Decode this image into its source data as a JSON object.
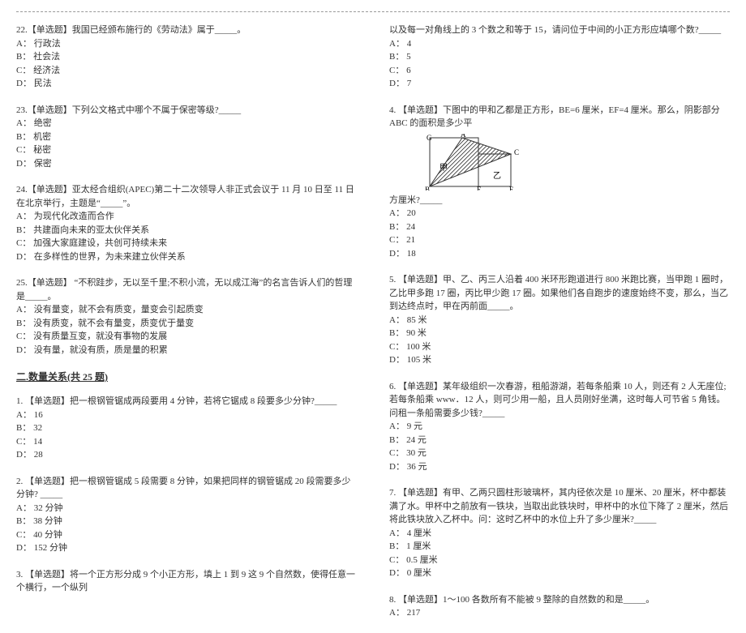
{
  "left": {
    "q22": {
      "stem": "22.【单选题】我国已经颁布施行的《劳动法》属于_____。",
      "a": "A： 行政法",
      "b": "B： 社会法",
      "c": "C： 经济法",
      "d": "D： 民法"
    },
    "q23": {
      "stem": "23.【单选题】下列公文格式中哪个不属于保密等级?_____",
      "a": "A： 绝密",
      "b": "B： 机密",
      "c": "C： 秘密",
      "d": "D： 保密"
    },
    "q24": {
      "stem": "24.【单选题】亚太经合组织(APEC)第二十二次领导人非正式会议于 11 月 10 日至 11 日在北京举行，主题是“_____”。",
      "a": "A： 为现代化改造而合作",
      "b": "B： 共建面向未来的亚太伙伴关系",
      "c": "C： 加强大家庭建设，共创可持续未来",
      "d": "D： 在多样性的世界，为未来建立伙伴关系"
    },
    "q25": {
      "stem": "25.【单选题】 “不积跬步，无以至千里;不积小流，无以成江海”的名言告诉人们的哲理是_____。",
      "a": "A： 没有量变，就不会有质变，量变会引起质变",
      "b": "B： 没有质变，就不会有量变，质变优于量变",
      "c": "C： 没有质量互变，就没有事物的发展",
      "d": "D： 没有量，就没有质，质是量的积累"
    },
    "section": "二.数量关系(共 25 题)",
    "q1b": {
      "stem": "1. 【单选题】把一根钢管锯成两段要用 4 分钟，若将它锯成 8 段要多少分钟?_____",
      "a": "A： 16",
      "b": "B： 32",
      "c": "C： 14",
      "d": "D： 28"
    },
    "q2b": {
      "stem": "2. 【单选题】把一根钢管锯成 5 段需要 8 分钟，如果把同样的钢管锯成 20 段需要多少分钟? _____",
      "a": "A： 32 分钟",
      "b": "B： 38 分钟",
      "c": "C： 40 分钟",
      "d": "D： 152 分钟"
    },
    "q3b": {
      "stem": "3. 【单选题】将一个正方形分成 9 个小正方形，填上 1 到 9 这 9 个自然数，使得任意一个横行，一个纵列"
    }
  },
  "right": {
    "q3cont": {
      "stem": "以及每一对角线上的 3 个数之和等于 15，请问位于中间的小正方形应填哪个数?_____",
      "a": "A： 4",
      "b": "B： 5",
      "c": "C： 6",
      "d": "D： 7"
    },
    "q4": {
      "stem": "4. 【单选题】下图中的甲和乙都是正方形，BE=6 厘米，EF=4 厘米。那么，阴影部分 ABC 的面积是多少平",
      "cont": "方厘米?_____",
      "a": "A： 20",
      "b": "B： 24",
      "c": "C： 21",
      "d": "D： 18",
      "labels": {
        "G": "G",
        "A": "A",
        "B": "B",
        "E": "E",
        "F": "F",
        "C": "C",
        "jia": "甲",
        "yi": "乙"
      }
    },
    "q5": {
      "stem": "5. 【单选题】甲、乙、丙三人沿着 400 米环形跑道进行 800 米跑比赛，当甲跑 1 圈时，乙比甲多跑 17 圈，丙比甲少跑 17 圈。如果他们各自跑步的速度始终不变，那么，当乙到达终点时，甲在丙前面_____。",
      "a": "A： 85 米",
      "b": "B： 90 米",
      "c": "C： 100 米",
      "d": "D： 105 米"
    },
    "q6": {
      "stem": "6. 【单选题】某年级组织一次春游，租船游湖，若每条船乘 10 人，则还有 2 人无座位;若每条船乘 www．12 人，则可少用一船，且人员刚好坐满，这时每人可节省 5 角钱。问租一条船需要多少钱?_____",
      "a": "A： 9 元",
      "b": "B： 24 元",
      "c": "C： 30 元",
      "d": "D： 36 元"
    },
    "q7": {
      "stem": "7. 【单选题】有甲、乙两只圆柱形玻璃杯，其内径依次是 10 厘米、20 厘米，杯中都装满了水。甲杯中之前放有一铁块，当取出此铁块时，甲杯中的水位下降了 2 厘米，然后将此铁块放入乙杯中。问：这时乙杯中的水位上升了多少厘米?_____",
      "a": "A： 4 厘米",
      "b": "B： 1 厘米",
      "c": "C： 0.5 厘米",
      "d": "D： 0 厘米"
    },
    "q8": {
      "stem": "8. 【单选题】1～100 各数所有不能被 9 整除的自然数的和是_____。",
      "a": "A： 217"
    }
  }
}
